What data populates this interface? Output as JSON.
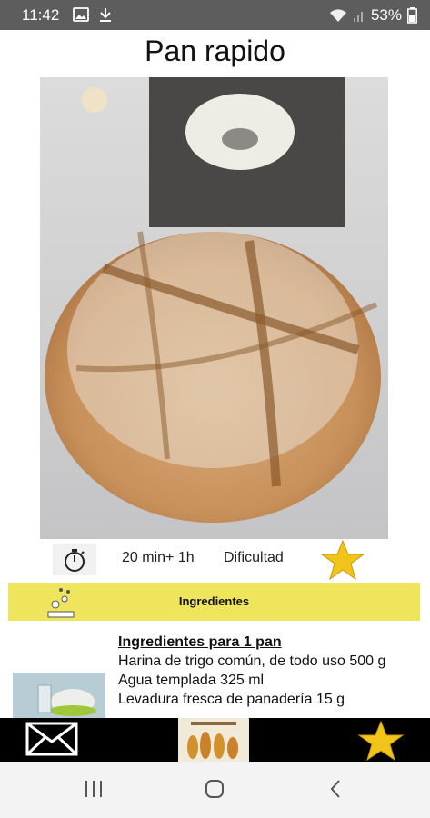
{
  "status_bar": {
    "time": "11:42",
    "battery": "53%",
    "icons": [
      "image-icon",
      "download-icon",
      "wifi-icon",
      "signal-icon",
      "battery-icon"
    ]
  },
  "recipe": {
    "title": "Pan rapido",
    "image": "bread-loaf-photo"
  },
  "meta": {
    "time": "20 min+ 1h",
    "difficulty_label": "Dificultad",
    "difficulty_icon": "star-icon"
  },
  "ingredients_tab": {
    "label": "Ingredientes"
  },
  "ingredients": {
    "heading": "Ingredientes para 1 pan",
    "lines": [
      "Harina de trigo común, de todo uso 500 g",
      "Agua templada 325 ml",
      "Levadura fresca de panadería 15 g"
    ]
  },
  "bottom_nav": {
    "icons": [
      "mail-icon",
      "app-logo",
      "star-icon"
    ]
  },
  "system_nav": {
    "icons": [
      "recent-apps-icon",
      "home-icon",
      "back-icon"
    ]
  },
  "colors": {
    "status_bar": "#5d5d5d",
    "ingredient_bar": "#efe55c",
    "star": "#f0c419",
    "bottom_bar": "#000000"
  }
}
